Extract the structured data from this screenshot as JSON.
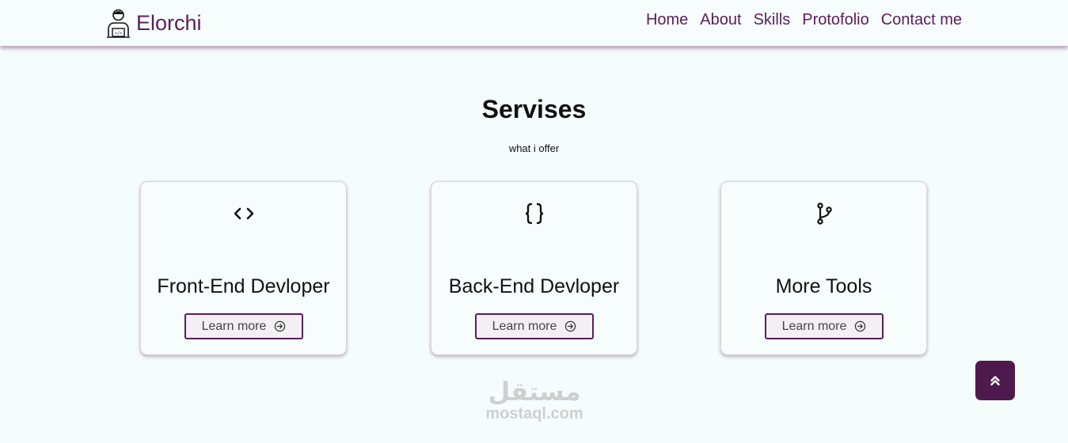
{
  "brand": {
    "name": "Elorchi",
    "icon": "developer-avatar-icon"
  },
  "nav": {
    "items": [
      "Home",
      "About",
      "Skills",
      "Protofolio",
      "Contact me"
    ]
  },
  "section": {
    "title": "Servises",
    "subtitle": "what i offer"
  },
  "cards": [
    {
      "icon": "code-brackets-icon",
      "title": "Front-End Devloper",
      "button": "Learn more"
    },
    {
      "icon": "curly-braces-icon",
      "title": "Back-End Devloper",
      "button": "Learn more"
    },
    {
      "icon": "git-branch-icon",
      "title": "More Tools",
      "button": "Learn more"
    }
  ],
  "watermark": {
    "arabic": "مستقل",
    "latin": "mostaql.com"
  },
  "scroll_top": {
    "icon": "double-chevron-up-icon"
  },
  "colors": {
    "accent": "#5a1e5a",
    "background": "#f5fcfc",
    "scroll_button": "#4e1a4e"
  }
}
